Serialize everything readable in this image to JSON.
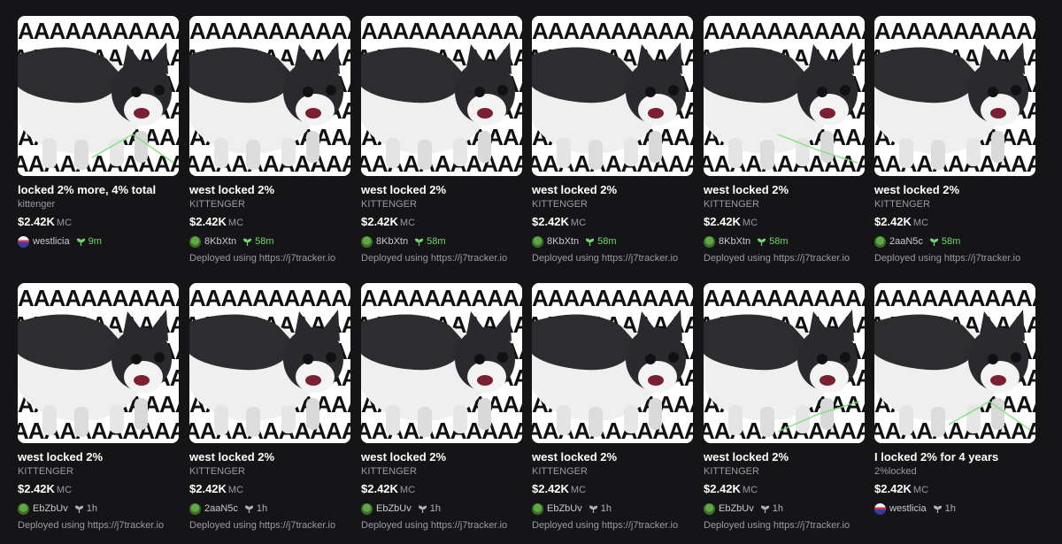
{
  "cards": [
    {
      "title": "locked 2% more, 4% total",
      "ticker": "kittenger",
      "mc": "$2.42K",
      "mc_unit": "MC",
      "creator": "westlicia",
      "avatar": "flag-avatar",
      "age": "9m",
      "age_style": "recent",
      "deployed": "",
      "chart": "up-down"
    },
    {
      "title": "west locked 2%",
      "ticker": "KITTENGER",
      "mc": "$2.42K",
      "mc_unit": "MC",
      "creator": "8KbXtn",
      "avatar": "frog-avatar",
      "age": "58m",
      "age_style": "recent",
      "deployed": "Deployed using https://j7tracker.io",
      "chart": ""
    },
    {
      "title": "west locked 2%",
      "ticker": "KITTENGER",
      "mc": "$2.42K",
      "mc_unit": "MC",
      "creator": "8KbXtn",
      "avatar": "frog-avatar",
      "age": "58m",
      "age_style": "recent",
      "deployed": "Deployed using https://j7tracker.io",
      "chart": ""
    },
    {
      "title": "west locked 2%",
      "ticker": "KITTENGER",
      "mc": "$2.42K",
      "mc_unit": "MC",
      "creator": "8KbXtn",
      "avatar": "frog-avatar",
      "age": "58m",
      "age_style": "recent",
      "deployed": "Deployed using https://j7tracker.io",
      "chart": ""
    },
    {
      "title": "west locked 2%",
      "ticker": "KITTENGER",
      "mc": "$2.42K",
      "mc_unit": "MC",
      "creator": "8KbXtn",
      "avatar": "frog-avatar",
      "age": "58m",
      "age_style": "recent",
      "deployed": "Deployed using https://j7tracker.io",
      "chart": "down"
    },
    {
      "title": "west locked 2%",
      "ticker": "KITTENGER",
      "mc": "$2.42K",
      "mc_unit": "MC",
      "creator": "2aaN5c",
      "avatar": "frog-avatar",
      "age": "58m",
      "age_style": "recent",
      "deployed": "Deployed using https://j7tracker.io",
      "chart": ""
    },
    {
      "title": "west locked 2%",
      "ticker": "KITTENGER",
      "mc": "$2.42K",
      "mc_unit": "MC",
      "creator": "EbZbUv",
      "avatar": "frog-avatar",
      "age": "1h",
      "age_style": "old",
      "deployed": "Deployed using https://j7tracker.io",
      "chart": ""
    },
    {
      "title": "west locked 2%",
      "ticker": "KITTENGER",
      "mc": "$2.42K",
      "mc_unit": "MC",
      "creator": "2aaN5c",
      "avatar": "frog-avatar",
      "age": "1h",
      "age_style": "old",
      "deployed": "Deployed using https://j7tracker.io",
      "chart": ""
    },
    {
      "title": "west locked 2%",
      "ticker": "KITTENGER",
      "mc": "$2.42K",
      "mc_unit": "MC",
      "creator": "EbZbUv",
      "avatar": "frog-avatar",
      "age": "1h",
      "age_style": "old",
      "deployed": "Deployed using https://j7tracker.io",
      "chart": ""
    },
    {
      "title": "west locked 2%",
      "ticker": "KITTENGER",
      "mc": "$2.42K",
      "mc_unit": "MC",
      "creator": "EbZbUv",
      "avatar": "frog-avatar",
      "age": "1h",
      "age_style": "old",
      "deployed": "Deployed using https://j7tracker.io",
      "chart": ""
    },
    {
      "title": "west locked 2%",
      "ticker": "KITTENGER",
      "mc": "$2.42K",
      "mc_unit": "MC",
      "creator": "EbZbUv",
      "avatar": "frog-avatar",
      "age": "1h",
      "age_style": "old",
      "deployed": "Deployed using https://j7tracker.io",
      "chart": "up"
    },
    {
      "title": "I locked 2% for 4 years",
      "ticker": "2%locked",
      "mc": "$2.42K",
      "mc_unit": "MC",
      "creator": "westlicia",
      "avatar": "flag-avatar",
      "age": "1h",
      "age_style": "old",
      "deployed": "",
      "chart": "up-down"
    }
  ],
  "thumb_text": "AAAAAAAAAAAAAA",
  "colors": {
    "background": "#151518",
    "accent_green": "#6fd66a",
    "muted": "#9a9aa2",
    "sparkline": "#7be07a"
  }
}
